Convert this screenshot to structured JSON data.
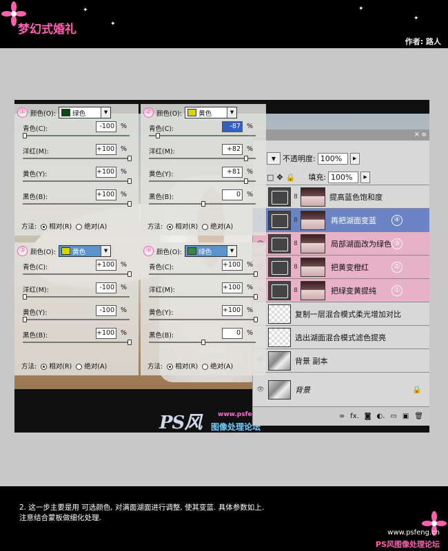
{
  "header": {
    "title": "梦幻式婚礼",
    "author": "作者: 路人"
  },
  "layers_panel": {
    "opacity_label": "不透明度:",
    "opacity_value": "100%",
    "fill_label": "填充:",
    "fill_value": "100%",
    "layers": [
      {
        "name": "提高蓝色饱和度",
        "num": ""
      },
      {
        "name": "再把湖面变蓝",
        "num": "④"
      },
      {
        "name": "局部湖面改为绿色",
        "num": "③"
      },
      {
        "name": "把黄变橙红",
        "num": "②"
      },
      {
        "name": "把绿变黄提纯",
        "num": "①"
      },
      {
        "name": "复制一层混合模式柔光增加对比"
      },
      {
        "name": "选出湖面混合模式滤色提亮"
      },
      {
        "name": "背景 副本"
      },
      {
        "name": "背景"
      }
    ]
  },
  "dialogs": [
    {
      "num": "①",
      "color_label": "颜色(O):",
      "color_value": "绿色",
      "swatch": "#0b4a16",
      "rows": [
        {
          "label": "青色(C):",
          "value": "-100",
          "level": -100
        },
        {
          "label": "洋红(M):",
          "value": "+100",
          "level": 100
        },
        {
          "label": "黄色(Y):",
          "value": "+100",
          "level": 100
        },
        {
          "label": "黑色(B):",
          "value": "+100",
          "level": 100
        }
      ],
      "method_label": "方法:",
      "relative": "相对(R)",
      "absolute": "绝对(A)"
    },
    {
      "num": "②",
      "color_label": "颜色(O):",
      "color_value": "黄色",
      "swatch": "#d8d400",
      "rows": [
        {
          "label": "青色(C):",
          "value": "-87",
          "level": -87,
          "highlight": true
        },
        {
          "label": "洋红(M):",
          "value": "+82",
          "level": 82
        },
        {
          "label": "黄色(Y):",
          "value": "+81",
          "level": 81
        },
        {
          "label": "黑色(B):",
          "value": "0",
          "level": 0
        }
      ],
      "method_label": "方法:",
      "relative": "相对(R)",
      "absolute": "绝对(A)"
    },
    {
      "num": "③",
      "color_label": "颜色(O):",
      "color_value": "黄色",
      "swatch": "#d8d400",
      "rows": [
        {
          "label": "青色(C):",
          "value": "+100",
          "level": 100
        },
        {
          "label": "洋红(M):",
          "value": "-100",
          "level": -100
        },
        {
          "label": "黄色(Y):",
          "value": "-100",
          "level": -100
        },
        {
          "label": "黑色(B):",
          "value": "+100",
          "level": 100
        }
      ],
      "method_label": "方法:",
      "relative": "相对(R)",
      "absolute": "绝对(A)"
    },
    {
      "num": "④",
      "color_label": "颜色(O):",
      "color_value": "绿色",
      "swatch": "#2f8c3a",
      "rows": [
        {
          "label": "青色(C):",
          "value": "+100",
          "level": 100
        },
        {
          "label": "洋红(M):",
          "value": "+100",
          "level": 100
        },
        {
          "label": "黄色(Y):",
          "value": "+100",
          "level": 100
        },
        {
          "label": "黑色(B):",
          "value": "0",
          "level": 0
        }
      ],
      "method_label": "方法:",
      "relative": "相对(R)",
      "absolute": "绝对(A)"
    }
  ],
  "watermark": {
    "url": "www.psfeng.cn",
    "name": "图像处理论坛",
    "logo": "PS风"
  },
  "caption": {
    "line1": "2. 这一步主要是用  可选颜色, 对满面湖面进行调整, 使其变蓝. 具体参数如上.",
    "line2": "注意结合蒙板做细化处理."
  },
  "footer": {
    "url": "www.psfeng.cn",
    "name": "PS风图像处理论坛"
  }
}
